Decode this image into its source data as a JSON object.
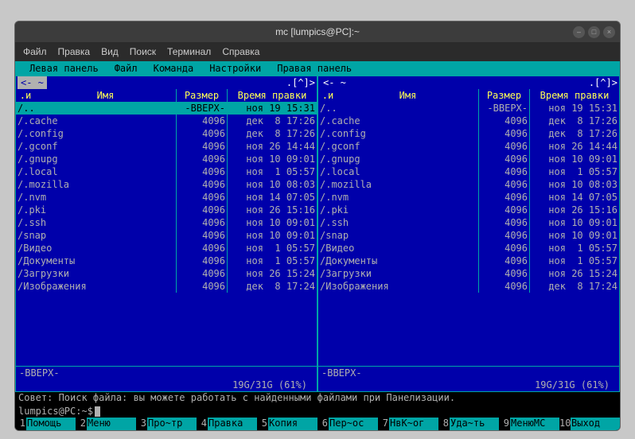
{
  "window": {
    "title": "mc [lumpics@PC]:~"
  },
  "app_menu": [
    "Файл",
    "Правка",
    "Вид",
    "Поиск",
    "Терминал",
    "Справка"
  ],
  "mc_menu": [
    "Левая панель",
    "Файл",
    "Команда",
    "Настройки",
    "Правая панель"
  ],
  "header": {
    "n": ".и",
    "name": "Имя",
    "size": "Размер",
    "date": "Время правки"
  },
  "path_indicator_left": "<- ~",
  "path_indicator_right": "<- ~",
  "corner": ".[^]>",
  "files": [
    {
      "name": "/..",
      "size": "-ВВЕРХ-",
      "date": "ноя 19 15:31",
      "sel": true
    },
    {
      "name": "/.cache",
      "size": "4096",
      "date": "дек  8 17:26"
    },
    {
      "name": "/.config",
      "size": "4096",
      "date": "дек  8 17:26"
    },
    {
      "name": "/.gconf",
      "size": "4096",
      "date": "ноя 26 14:44"
    },
    {
      "name": "/.gnupg",
      "size": "4096",
      "date": "ноя 10 09:01"
    },
    {
      "name": "/.local",
      "size": "4096",
      "date": "ноя  1 05:57"
    },
    {
      "name": "/.mozilla",
      "size": "4096",
      "date": "ноя 10 08:03"
    },
    {
      "name": "/.nvm",
      "size": "4096",
      "date": "ноя 14 07:05"
    },
    {
      "name": "/.pki",
      "size": "4096",
      "date": "ноя 26 15:16"
    },
    {
      "name": "/.ssh",
      "size": "4096",
      "date": "ноя 10 09:01"
    },
    {
      "name": "/snap",
      "size": "4096",
      "date": "ноя 10 09:01"
    },
    {
      "name": "/Видео",
      "size": "4096",
      "date": "ноя  1 05:57"
    },
    {
      "name": "/Документы",
      "size": "4096",
      "date": "ноя  1 05:57"
    },
    {
      "name": "/Загрузки",
      "size": "4096",
      "date": "ноя 26 15:24"
    },
    {
      "name": "/Изображения",
      "size": "4096",
      "date": "дек  8 17:24"
    }
  ],
  "panel_footer": "-ВВЕРХ-",
  "panel_status": "19G/31G (61%)",
  "hint": "Совет: Поиск файла: вы можете работать с найденными файлами при Панелизации.",
  "prompt": "lumpics@PC:~$",
  "fkeys": [
    {
      "n": "1",
      "l": "Помощь"
    },
    {
      "n": "2",
      "l": "Меню"
    },
    {
      "n": "3",
      "l": "Про~тр"
    },
    {
      "n": "4",
      "l": "Правка"
    },
    {
      "n": "5",
      "l": "Копия"
    },
    {
      "n": "6",
      "l": "Пер~ос"
    },
    {
      "n": "7",
      "l": "НвК~ог"
    },
    {
      "n": "8",
      "l": "Уда~ть"
    },
    {
      "n": "9",
      "l": "МенюМС"
    },
    {
      "n": "10",
      "l": "Выход"
    }
  ]
}
